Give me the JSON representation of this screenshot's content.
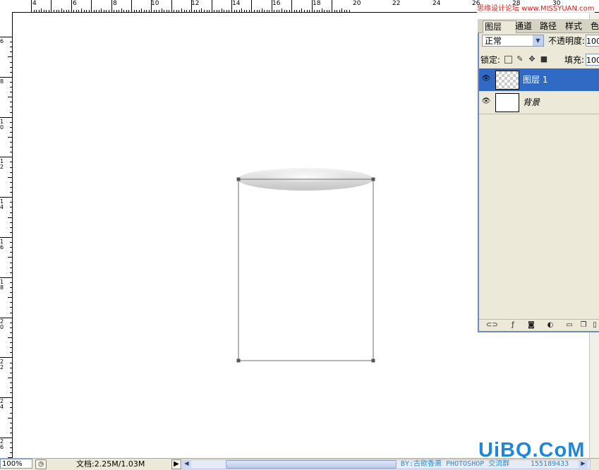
{
  "ruler": {
    "top_labels": [
      "4",
      "6",
      "8",
      "10",
      "12",
      "14",
      "16",
      "18",
      "20",
      "22",
      "24",
      "26",
      "28",
      "30"
    ],
    "left_labels": [
      "6",
      "8",
      "10",
      "12",
      "14",
      "16",
      "18",
      "20",
      "22",
      "24",
      "26"
    ]
  },
  "site_mark": "思缘设计论坛 www.MISSYUAN.com",
  "panel": {
    "tabs": [
      "图层",
      "通道",
      "路径",
      "样式",
      "色"
    ],
    "blend_mode": "正常",
    "opacity_label": "不透明度:",
    "opacity_value": "100",
    "lock_label": "锁定:",
    "fill_label": "填充:",
    "fill_value": "100",
    "layers": [
      {
        "name": "图层 1",
        "selected": true
      },
      {
        "name": "背景",
        "selected": false
      }
    ],
    "icons": [
      "eye-icon",
      "link-icon",
      "layer-style-icon",
      "mask-icon",
      "adjustment-icon",
      "new-group-icon",
      "new-layer-icon",
      "trash-icon"
    ]
  },
  "status": {
    "zoom": "100%",
    "doc_info": "文档:2.25M/1.03M"
  },
  "credit": {
    "text": "BY:古欲香萧  PHOTOSHOP 交流群",
    "qq": "155189433"
  },
  "watermark": "UiBQ.CoM",
  "colors": {
    "selection_blue": "#316ac5",
    "panel_bg": "#ece9d8",
    "watermark": "#1e88d8"
  }
}
